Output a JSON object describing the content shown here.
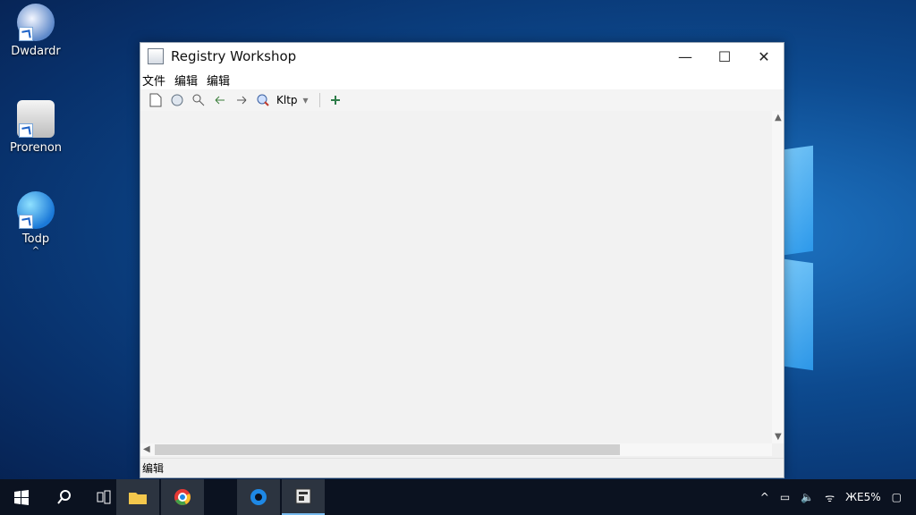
{
  "desktop": {
    "icons": [
      {
        "label": "Dwdardr"
      },
      {
        "label": "Prorenon"
      },
      {
        "label": "Todp"
      }
    ]
  },
  "window": {
    "title": "Registry Workshop",
    "minimize_symbol": "—",
    "maximize_symbol": "☐",
    "close_symbol": "✕",
    "menu": [
      "文件",
      "编辑",
      "编辑"
    ],
    "toolbar": {
      "icons": [
        "new-file-icon",
        "save-icon",
        "find-icon",
        "back-icon",
        "forward-icon",
        "search-icon"
      ],
      "search_label": "Kltp",
      "dropdown_symbol": "▾",
      "extra_icon": "plus-icon"
    },
    "status_text": "编辑"
  },
  "taskbar": {
    "tray_text": "ЖЕ5%",
    "items": [
      "start-icon",
      "search-icon",
      "task-view-icon",
      "file-explorer-icon",
      "chrome-icon",
      "edge-icon",
      "registry-app-icon"
    ]
  },
  "colors": {
    "accent": "#1d62c7",
    "taskbar": "#0b1220"
  }
}
